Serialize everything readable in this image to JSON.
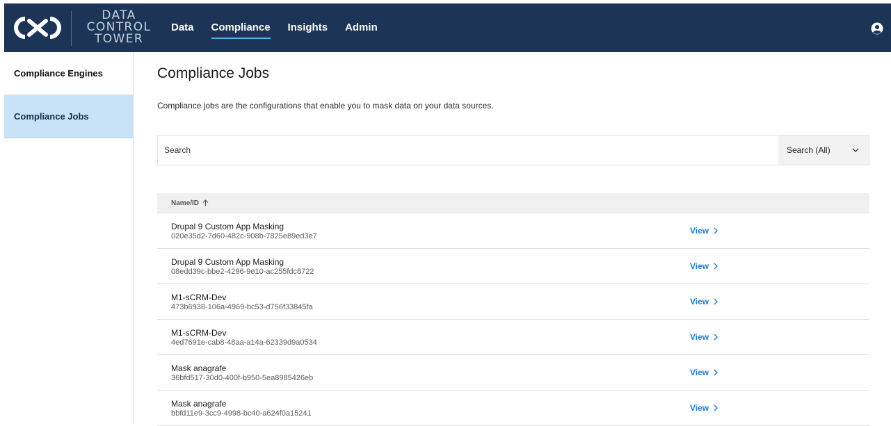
{
  "logo": {
    "line1": "DATA",
    "line2": "CONTROL",
    "line3": "TOWER"
  },
  "nav": {
    "items": [
      {
        "label": "Data",
        "active": false
      },
      {
        "label": "Compliance",
        "active": true
      },
      {
        "label": "Insights",
        "active": false
      },
      {
        "label": "Admin",
        "active": false
      }
    ]
  },
  "sidebar": {
    "items": [
      {
        "label": "Compliance Engines",
        "active": false
      },
      {
        "label": "Compliance Jobs",
        "active": true
      }
    ]
  },
  "page": {
    "title": "Compliance Jobs",
    "description": "Compliance jobs are the configurations that enable you to mask data on your data sources."
  },
  "search": {
    "placeholder": "Search",
    "scope": "Search (All)"
  },
  "table": {
    "column_header": "Name/ID",
    "sort": "ascending",
    "view_label": "View",
    "rows": [
      {
        "name": "Drupal 9 Custom App Masking",
        "id": "020e35d2-7d60-482c-908b-7825e89ed3e7"
      },
      {
        "name": "Drupal 9 Custom App Masking",
        "id": "08edd39c-bbe2-4296-9e10-ac255fdc8722"
      },
      {
        "name": "M1-sCRM-Dev",
        "id": "473b6938-106a-4969-bc53-d756f33845fa"
      },
      {
        "name": "M1-sCRM-Dev",
        "id": "4ed7691e-cab8-48aa-a14a-62339d9a0534"
      },
      {
        "name": "Mask anagrafe",
        "id": "36bfd517-30d0-400f-b950-5ea8985426eb"
      },
      {
        "name": "Mask anagrafe",
        "id": "bbfd11e9-3cc9-4998-bc40-a624f0a15241"
      }
    ]
  },
  "colors": {
    "topbar": "#1c3557",
    "accent": "#1f7bd1",
    "active_sidebar": "#c8e3f8"
  }
}
